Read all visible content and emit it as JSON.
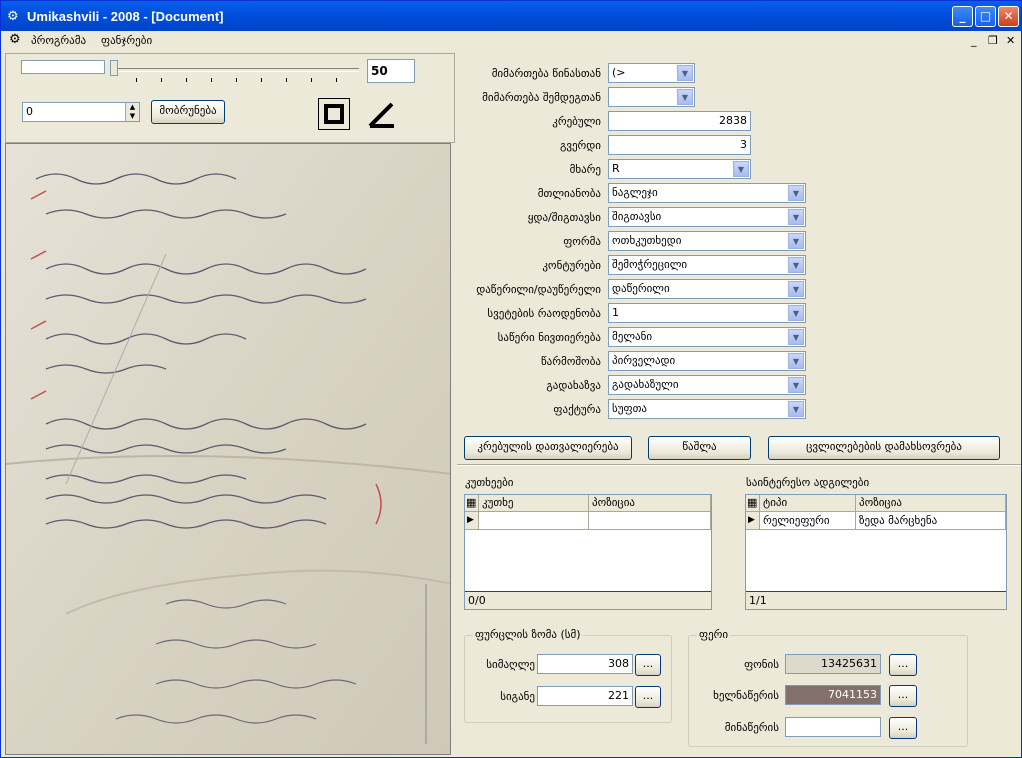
{
  "window": {
    "title": "Umikashvili - 2008 - [Document]"
  },
  "menu": {
    "items": [
      "პროგრამა",
      "ფანჯრები"
    ]
  },
  "left": {
    "zoom_value": "50",
    "rotation_value": "0",
    "rotate_button": "მობრუნება"
  },
  "form": {
    "fields": [
      {
        "label": "მიმართება წინასთან",
        "value": "(>",
        "type": "combo-small"
      },
      {
        "label": "მიმართება შემდეგთან",
        "value": "",
        "type": "combo-small"
      },
      {
        "label": "კრებული",
        "value": "2838",
        "type": "number"
      },
      {
        "label": "გვერდი",
        "value": "3",
        "type": "number"
      },
      {
        "label": "მხარე",
        "value": "R",
        "type": "combo-mid"
      },
      {
        "label": "მთლიანობა",
        "value": "ნაგლეჯი",
        "type": "combo"
      },
      {
        "label": "ყდა/შიგთავსი",
        "value": "შიგთავსი",
        "type": "combo"
      },
      {
        "label": "ფორმა",
        "value": "ოთხკუთხედი",
        "type": "combo"
      },
      {
        "label": "კონტურები",
        "value": "შემოჭრეცილი",
        "type": "combo"
      },
      {
        "label": "დაწერილი/დაუწერელი",
        "value": "დაწერილი",
        "type": "combo"
      },
      {
        "label": "სვეტების რაოდენობა",
        "value": "1",
        "type": "combo"
      },
      {
        "label": "საწერი ნივთიერება",
        "value": "მელანი",
        "type": "combo"
      },
      {
        "label": "წარმოშობა",
        "value": "პირველადი",
        "type": "combo"
      },
      {
        "label": "გადახაზვა",
        "value": "გადახაზული",
        "type": "combo"
      },
      {
        "label": "ფაქტურა",
        "value": "სუფთა",
        "type": "combo"
      }
    ],
    "buttons": {
      "recount": "კრებულის დათვალიერება",
      "delete": "წაშლა",
      "save": "ცვლილებების დამახსოვრება"
    }
  },
  "corners": {
    "title": "კუთხეები",
    "columns": [
      "კუთხე",
      "პოზიცია"
    ],
    "rows": [
      [
        "",
        ""
      ]
    ],
    "footer": "0/0"
  },
  "locations": {
    "title": "საინტერესო ადგილები",
    "columns": [
      "ტიპი",
      "პოზიცია"
    ],
    "rows": [
      [
        "რელიეფური",
        "ზედა მარცხენა"
      ]
    ],
    "footer": "1/1"
  },
  "size": {
    "title": "ფურცლის ზომა (სმ)",
    "height_label": "სიმაღლე",
    "height_value": "308",
    "width_label": "სიგანე",
    "width_value": "221",
    "ellipsis": "..."
  },
  "color": {
    "title": "ფერი",
    "bg_label": "ფონის",
    "bg_value": "13425631",
    "bg_color": "#dfd9cc",
    "hand_label": "ხელნაწერის",
    "hand_value": "7041153",
    "hand_color": "#81706b",
    "note_label": "მინაწერის",
    "note_value": ""
  }
}
